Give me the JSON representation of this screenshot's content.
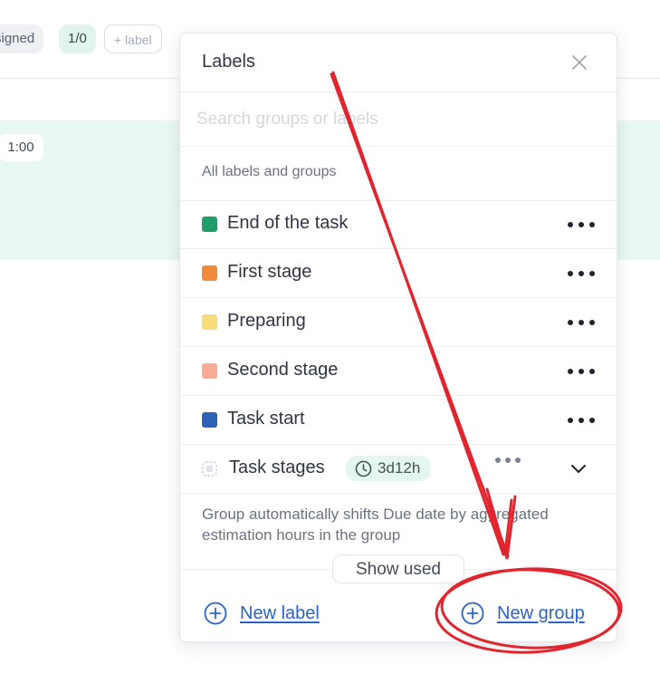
{
  "background": {
    "chips": {
      "assigned": "signed",
      "count": "1/0",
      "add_label": "+ label"
    },
    "time_chip": "1:00"
  },
  "popover": {
    "title": "Labels",
    "search": {
      "placeholder": "Search groups or labels"
    },
    "section_title": "All labels and groups",
    "labels": [
      {
        "name": "End of the task",
        "color": "#1f9e6a"
      },
      {
        "name": "First stage",
        "color": "#f08a3c"
      },
      {
        "name": "Preparing",
        "color": "#f7dc7a"
      },
      {
        "name": "Second stage",
        "color": "#f9ab94"
      },
      {
        "name": "Task start",
        "color": "#2e62b8"
      }
    ],
    "group": {
      "name": "Task stages",
      "estimate": "3d12h"
    },
    "group_description": "Group automatically shifts Due date by aggregated estimation hours in the group",
    "show_used_label": "Show used",
    "new_label": "New label",
    "new_group": "New group"
  },
  "colors": {
    "link": "#2b63c8",
    "annotation": "#e0252f"
  }
}
